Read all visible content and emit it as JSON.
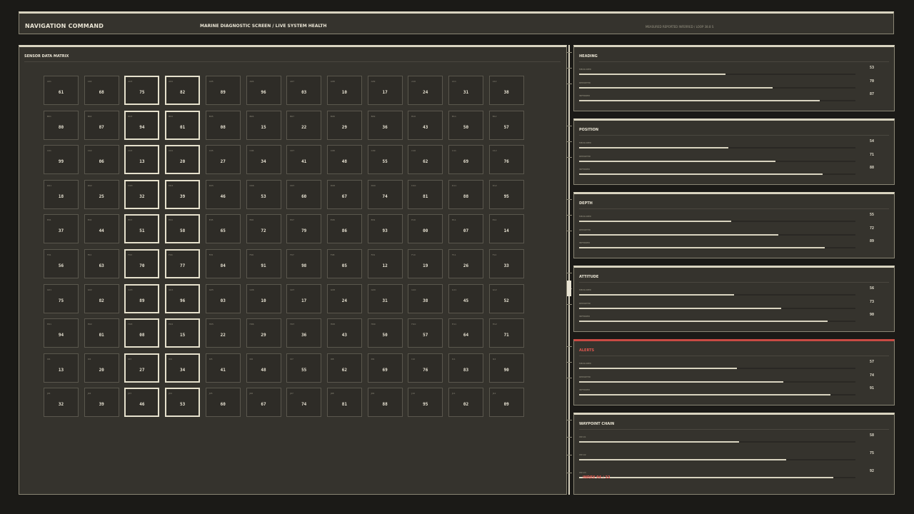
{
  "header": {
    "title": "NAVIGATION COMMAND",
    "subtitle": "MARINE DIAGNOSTIC SCREEN / LIVE SYSTEM HEALTH",
    "legend": "MEASURED  REPORTED  INFERRED  /  LOOP 38.8 S"
  },
  "matrix": {
    "title": "SENSOR DATA MATRIX",
    "highlight_columns": [
      2,
      3
    ],
    "rows": [
      {
        "ids": [
          "A01",
          "A02",
          "A03",
          "A04",
          "A05",
          "A06",
          "A07",
          "A08",
          "A09",
          "A10",
          "A11",
          "A12"
        ],
        "values": [
          "61",
          "68",
          "75",
          "82",
          "89",
          "96",
          "03",
          "10",
          "17",
          "24",
          "31",
          "38"
        ]
      },
      {
        "ids": [
          "B01",
          "B02",
          "B03",
          "B04",
          "B05",
          "B06",
          "B07",
          "B08",
          "B09",
          "B10",
          "B11",
          "B12"
        ],
        "values": [
          "80",
          "87",
          "94",
          "01",
          "08",
          "15",
          "22",
          "29",
          "36",
          "43",
          "50",
          "57"
        ]
      },
      {
        "ids": [
          "C01",
          "C02",
          "C03",
          "C04",
          "C05",
          "C06",
          "C07",
          "C08",
          "C09",
          "C10",
          "C11",
          "C12"
        ],
        "values": [
          "99",
          "06",
          "13",
          "20",
          "27",
          "34",
          "41",
          "48",
          "55",
          "62",
          "69",
          "76"
        ]
      },
      {
        "ids": [
          "D01",
          "D02",
          "D03",
          "D04",
          "D05",
          "D06",
          "D07",
          "D08",
          "D09",
          "D10",
          "D11",
          "D12"
        ],
        "values": [
          "18",
          "25",
          "32",
          "39",
          "46",
          "53",
          "60",
          "67",
          "74",
          "81",
          "88",
          "95"
        ]
      },
      {
        "ids": [
          "E01",
          "E02",
          "E03",
          "E04",
          "E05",
          "E06",
          "E07",
          "E08",
          "E09",
          "E10",
          "E11",
          "E12"
        ],
        "values": [
          "37",
          "44",
          "51",
          "58",
          "65",
          "72",
          "79",
          "86",
          "93",
          "00",
          "07",
          "14"
        ]
      },
      {
        "ids": [
          "F01",
          "F02",
          "F03",
          "F04",
          "F05",
          "F06",
          "F07",
          "F08",
          "F09",
          "F10",
          "F11",
          "F12"
        ],
        "values": [
          "56",
          "63",
          "70",
          "77",
          "84",
          "91",
          "98",
          "05",
          "12",
          "19",
          "26",
          "33"
        ]
      },
      {
        "ids": [
          "G01",
          "G02",
          "G03",
          "G04",
          "G05",
          "G06",
          "G07",
          "G08",
          "G09",
          "G10",
          "G11",
          "G12"
        ],
        "values": [
          "75",
          "82",
          "89",
          "96",
          "03",
          "10",
          "17",
          "24",
          "31",
          "38",
          "45",
          "52"
        ]
      },
      {
        "ids": [
          "H01",
          "H02",
          "H03",
          "H04",
          "H05",
          "H06",
          "H07",
          "H08",
          "H09",
          "H10",
          "H11",
          "H12"
        ],
        "values": [
          "94",
          "01",
          "08",
          "15",
          "22",
          "29",
          "36",
          "43",
          "50",
          "57",
          "64",
          "71"
        ]
      },
      {
        "ids": [
          "I01",
          "I02",
          "I03",
          "I04",
          "I05",
          "I06",
          "I07",
          "I08",
          "I09",
          "I10",
          "I11",
          "I12"
        ],
        "values": [
          "13",
          "20",
          "27",
          "34",
          "41",
          "48",
          "55",
          "62",
          "69",
          "76",
          "83",
          "90"
        ]
      },
      {
        "ids": [
          "J01",
          "J02",
          "J03",
          "J04",
          "J05",
          "J06",
          "J07",
          "J08",
          "J09",
          "J10",
          "J11",
          "J12"
        ],
        "values": [
          "32",
          "39",
          "46",
          "53",
          "60",
          "67",
          "74",
          "81",
          "88",
          "95",
          "02",
          "09"
        ]
      }
    ]
  },
  "panels": [
    {
      "title": "HEADING",
      "alert": false,
      "metrics": [
        {
          "label": "MEASURED",
          "value": "53",
          "fill": 0.53
        },
        {
          "label": "REPORTED",
          "value": "70",
          "fill": 0.7
        },
        {
          "label": "INFERRED",
          "value": "87",
          "fill": 0.87
        }
      ]
    },
    {
      "title": "POSITION",
      "alert": false,
      "metrics": [
        {
          "label": "MEASURED",
          "value": "54",
          "fill": 0.54
        },
        {
          "label": "REPORTED",
          "value": "71",
          "fill": 0.71
        },
        {
          "label": "INFERRED",
          "value": "88",
          "fill": 0.88
        }
      ]
    },
    {
      "title": "DEPTH",
      "alert": false,
      "metrics": [
        {
          "label": "MEASURED",
          "value": "55",
          "fill": 0.55
        },
        {
          "label": "REPORTED",
          "value": "72",
          "fill": 0.72
        },
        {
          "label": "INFERRED",
          "value": "89",
          "fill": 0.89
        }
      ]
    },
    {
      "title": "ATTITUDE",
      "alert": false,
      "metrics": [
        {
          "label": "MEASURED",
          "value": "56",
          "fill": 0.56
        },
        {
          "label": "REPORTED",
          "value": "73",
          "fill": 0.73
        },
        {
          "label": "INFERRED",
          "value": "90",
          "fill": 0.9
        }
      ]
    },
    {
      "title": "ALERTS",
      "alert": true,
      "metrics": [
        {
          "label": "MEASURED",
          "value": "57",
          "fill": 0.57
        },
        {
          "label": "REPORTED",
          "value": "74",
          "fill": 0.74
        },
        {
          "label": "INFERRED",
          "value": "91",
          "fill": 0.91
        }
      ]
    },
    {
      "title": "WAYPOINT CHAIN",
      "alert": false,
      "metrics": [
        {
          "label": "WP-01",
          "value": "58",
          "fill": 0.58
        },
        {
          "label": "WP-02",
          "value": "75",
          "fill": 0.75
        },
        {
          "label": "WP-03",
          "value": "92",
          "fill": 0.92,
          "warning": "INDEX 04 / 22"
        }
      ]
    }
  ],
  "colors": {
    "background": "#1b1a17",
    "panel": "#35332d",
    "accent": "#d9d4c0",
    "alert": "#c94a43"
  }
}
